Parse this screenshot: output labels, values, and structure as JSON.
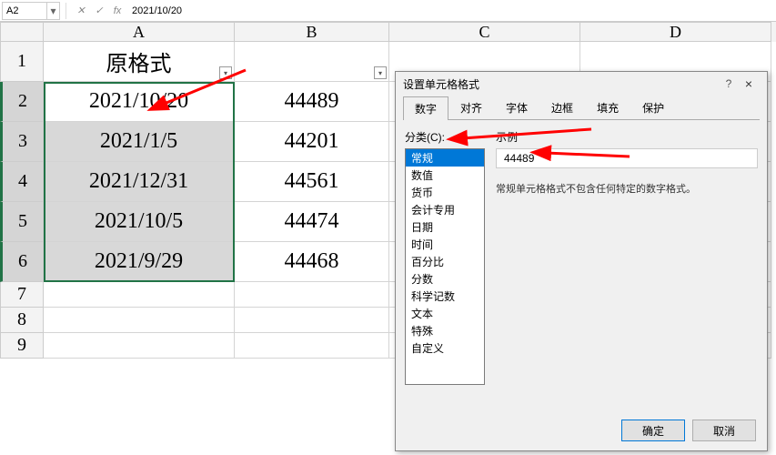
{
  "formula_bar": {
    "name_box": "A2",
    "fx_label": "fx",
    "content": "2021/10/20"
  },
  "columns": [
    "A",
    "B",
    "C",
    "D"
  ],
  "rows": [
    {
      "num": "1",
      "A": "原格式",
      "B": "",
      "tall": true,
      "sel": false,
      "filterA": true,
      "filterB": true
    },
    {
      "num": "2",
      "A": "2021/10/20",
      "B": "44489",
      "tall": true,
      "sel": true,
      "active": true
    },
    {
      "num": "3",
      "A": "2021/1/5",
      "B": "44201",
      "tall": true,
      "sel": true
    },
    {
      "num": "4",
      "A": "2021/12/31",
      "B": "44561",
      "tall": true,
      "sel": true
    },
    {
      "num": "5",
      "A": "2021/10/5",
      "B": "44474",
      "tall": true,
      "sel": true
    },
    {
      "num": "6",
      "A": "2021/9/29",
      "B": "44468",
      "tall": true,
      "sel": true
    },
    {
      "num": "7",
      "A": "",
      "B": "",
      "tall": false,
      "sel": false
    },
    {
      "num": "8",
      "A": "",
      "B": "",
      "tall": false,
      "sel": false
    },
    {
      "num": "9",
      "A": "",
      "B": "",
      "tall": false,
      "sel": false
    }
  ],
  "dialog": {
    "title": "设置单元格格式",
    "help": "?",
    "close": "×",
    "tabs": [
      "数字",
      "对齐",
      "字体",
      "边框",
      "填充",
      "保护"
    ],
    "active_tab": 0,
    "category_label": "分类(C):",
    "categories": [
      "常规",
      "数值",
      "货币",
      "会计专用",
      "日期",
      "时间",
      "百分比",
      "分数",
      "科学记数",
      "文本",
      "特殊",
      "自定义"
    ],
    "selected_category": 0,
    "sample_label": "示例",
    "sample_value": "44489",
    "description": "常规单元格格式不包含任何特定的数字格式。",
    "ok": "确定",
    "cancel": "取消"
  }
}
